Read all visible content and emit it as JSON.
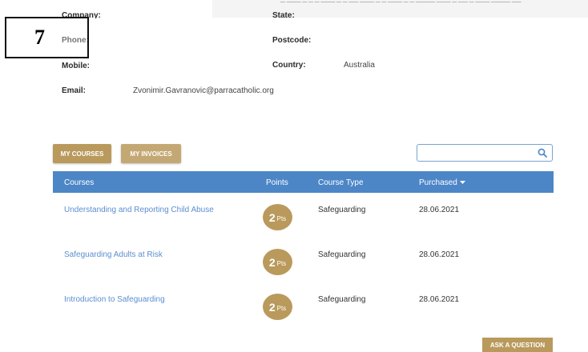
{
  "top_strip": {
    "text": "— ——— — — — ——— — — —— ——— — — ——— — — ———— ——— — —— — ——— ———— ——"
  },
  "profile": {
    "company_label": "Company:",
    "state_label": "State:",
    "phone_label": "Phone:",
    "postcode_label": "Postcode:",
    "mobile_label": "Mobile:",
    "country_label": "Country:",
    "country_value": "Australia",
    "email_label": "Email:",
    "email_value": "Zvonimir.Gavranovic@parracatholic.org"
  },
  "annotation": {
    "step_number": "7"
  },
  "tabs": {
    "my_courses": "MY COURSES",
    "my_invoices": "MY INVOICES"
  },
  "search": {
    "placeholder": "",
    "icon": "search-icon"
  },
  "table": {
    "headers": {
      "courses": "Courses",
      "points": "Points",
      "course_type": "Course Type",
      "purchased": "Purchased"
    },
    "rows": [
      {
        "course": "Understanding and Reporting Child Abuse",
        "points": "2",
        "points_unit": "Pts",
        "type": "Safeguarding",
        "purchased": "28.06.2021"
      },
      {
        "course": "Safeguarding Adults at Risk",
        "points": "2",
        "points_unit": "Pts",
        "type": "Safeguarding",
        "purchased": "28.06.2021"
      },
      {
        "course": "Introduction to Safeguarding",
        "points": "2",
        "points_unit": "Pts",
        "type": "Safeguarding",
        "purchased": "28.06.2021"
      }
    ]
  },
  "ask_question": {
    "label": "ASK A QUESTION"
  },
  "colors": {
    "gold": "#b99a5c",
    "header_blue": "#4c86c6",
    "link_blue": "#5b8ed0"
  }
}
